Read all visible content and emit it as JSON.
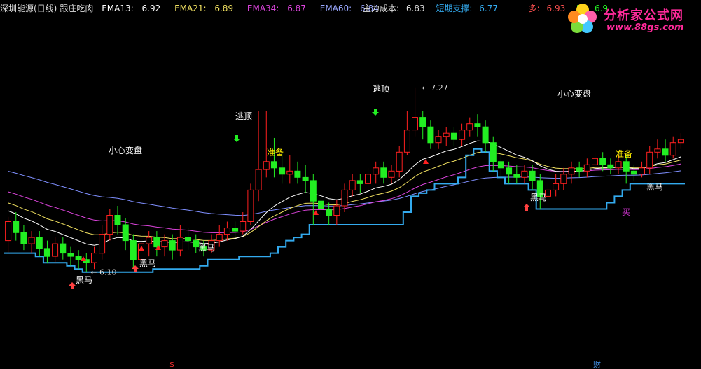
{
  "header": {
    "stock": "深圳能源(日线)",
    "indicator": "跟庄吃肉",
    "ema13_label": "EMA13:",
    "ema13_value": "6.92",
    "ema21_label": "EMA21:",
    "ema21_value": "6.89",
    "ema34_label": "EMA34:",
    "ema34_value": "6.87",
    "ema60_label": "EMA60:",
    "ema60_value": "6.84",
    "cost_label": "主力成本:",
    "cost_value": "6.83",
    "support_label": "短期支撑:",
    "support_value": "6.77",
    "long_label": "多:",
    "long_value": "6.93",
    "short_label": "空:",
    "short_value": "6.9"
  },
  "logo": {
    "title": "分析家公式网",
    "url": "www.88gs.com"
  },
  "colors": {
    "up": "#ff2020",
    "down": "#22ee22",
    "support": "#33aaee",
    "ema13": "#ffffff",
    "ema21": "#f0e060",
    "ema34": "#dd44dd",
    "ema60": "#7f8fff",
    "label": "#ffffff",
    "warn": "#ffee00"
  },
  "chart_data": {
    "type": "candlestick",
    "price_labels": [
      "6.10",
      "7.27"
    ],
    "annotations": [
      "小心变盘",
      "逃顶",
      "准备",
      "黑马",
      "买"
    ],
    "bottom_marks": [
      "$",
      "财"
    ],
    "candles": [
      [
        6.3,
        6.42,
        6.22,
        6.45
      ],
      [
        6.42,
        6.35,
        6.3,
        6.48
      ],
      [
        6.35,
        6.28,
        6.24,
        6.4
      ],
      [
        6.28,
        6.32,
        6.22,
        6.36
      ],
      [
        6.32,
        6.25,
        6.2,
        6.36
      ],
      [
        6.25,
        6.2,
        6.16,
        6.3
      ],
      [
        6.2,
        6.28,
        6.16,
        6.32
      ],
      [
        6.28,
        6.22,
        6.18,
        6.32
      ],
      [
        6.22,
        6.2,
        6.14,
        6.26
      ],
      [
        6.2,
        6.18,
        6.12,
        6.24
      ],
      [
        6.18,
        6.16,
        6.1,
        6.22
      ],
      [
        6.16,
        6.22,
        6.12,
        6.26
      ],
      [
        6.22,
        6.34,
        6.18,
        6.4
      ],
      [
        6.34,
        6.46,
        6.3,
        6.5
      ],
      [
        6.46,
        6.4,
        6.34,
        6.52
      ],
      [
        6.4,
        6.3,
        6.24,
        6.44
      ],
      [
        6.3,
        6.18,
        6.12,
        6.34
      ],
      [
        6.18,
        6.28,
        6.14,
        6.32
      ],
      [
        6.28,
        6.32,
        6.2,
        6.36
      ],
      [
        6.32,
        6.26,
        6.2,
        6.36
      ],
      [
        6.26,
        6.3,
        6.2,
        6.34
      ],
      [
        6.3,
        6.24,
        6.18,
        6.34
      ],
      [
        6.24,
        6.32,
        6.2,
        6.4
      ],
      [
        6.32,
        6.3,
        6.24,
        6.38
      ],
      [
        6.3,
        6.26,
        6.22,
        6.34
      ],
      [
        6.26,
        6.24,
        6.2,
        6.3
      ],
      [
        6.24,
        6.3,
        6.22,
        6.34
      ],
      [
        6.3,
        6.34,
        6.26,
        6.4
      ],
      [
        6.34,
        6.38,
        6.3,
        6.42
      ],
      [
        6.38,
        6.36,
        6.32,
        6.42
      ],
      [
        6.36,
        6.42,
        6.34,
        6.48
      ],
      [
        6.42,
        6.62,
        6.4,
        6.66
      ],
      [
        6.62,
        6.75,
        6.55,
        7.12
      ],
      [
        6.75,
        6.8,
        6.7,
        7.12
      ],
      [
        6.8,
        6.76,
        6.7,
        6.95
      ],
      [
        6.76,
        6.72,
        6.66,
        6.86
      ],
      [
        6.72,
        6.74,
        6.66,
        6.84
      ],
      [
        6.74,
        6.7,
        6.66,
        6.8
      ],
      [
        6.7,
        6.68,
        6.6,
        6.78
      ],
      [
        6.68,
        6.55,
        6.4,
        6.72
      ],
      [
        6.55,
        6.5,
        6.44,
        6.58
      ],
      [
        6.5,
        6.46,
        6.4,
        6.54
      ],
      [
        6.46,
        6.52,
        6.4,
        6.56
      ],
      [
        6.52,
        6.62,
        6.48,
        6.66
      ],
      [
        6.62,
        6.68,
        6.58,
        6.72
      ],
      [
        6.68,
        6.66,
        6.6,
        6.72
      ],
      [
        6.66,
        6.72,
        6.62,
        6.76
      ],
      [
        6.72,
        6.76,
        6.66,
        6.8
      ],
      [
        6.76,
        6.7,
        6.66,
        6.8
      ],
      [
        6.7,
        6.74,
        6.66,
        6.78
      ],
      [
        6.74,
        6.86,
        6.7,
        6.9
      ],
      [
        6.86,
        7.0,
        6.84,
        7.12
      ],
      [
        7.0,
        7.08,
        6.96,
        7.27
      ],
      [
        7.08,
        7.02,
        6.94,
        7.12
      ],
      [
        7.02,
        6.92,
        6.88,
        7.06
      ],
      [
        6.92,
        6.96,
        6.88,
        7.0
      ],
      [
        6.96,
        6.98,
        6.9,
        7.02
      ],
      [
        6.98,
        6.94,
        6.9,
        7.02
      ],
      [
        6.94,
        7.0,
        6.9,
        7.04
      ],
      [
        7.0,
        7.04,
        6.96,
        7.08
      ],
      [
        7.04,
        7.02,
        6.96,
        7.1
      ],
      [
        7.02,
        6.92,
        6.86,
        7.06
      ],
      [
        6.92,
        6.8,
        6.74,
        6.96
      ],
      [
        6.8,
        6.76,
        6.7,
        6.84
      ],
      [
        6.76,
        6.72,
        6.66,
        6.8
      ],
      [
        6.72,
        6.7,
        6.66,
        6.78
      ],
      [
        6.7,
        6.74,
        6.66,
        6.78
      ],
      [
        6.74,
        6.68,
        6.62,
        6.78
      ],
      [
        6.68,
        6.58,
        6.5,
        6.72
      ],
      [
        6.58,
        6.62,
        6.54,
        6.66
      ],
      [
        6.62,
        6.66,
        6.58,
        6.72
      ],
      [
        6.66,
        6.72,
        6.62,
        6.76
      ],
      [
        6.72,
        6.76,
        6.66,
        6.8
      ],
      [
        6.76,
        6.74,
        6.7,
        6.8
      ],
      [
        6.74,
        6.78,
        6.7,
        6.82
      ],
      [
        6.78,
        6.82,
        6.74,
        6.86
      ],
      [
        6.82,
        6.78,
        6.74,
        6.86
      ],
      [
        6.78,
        6.76,
        6.72,
        6.82
      ],
      [
        6.76,
        6.8,
        6.72,
        6.84
      ],
      [
        6.8,
        6.74,
        6.66,
        6.84
      ],
      [
        6.74,
        6.72,
        6.68,
        6.78
      ],
      [
        6.72,
        6.76,
        6.7,
        6.8
      ],
      [
        6.76,
        6.86,
        6.72,
        6.9
      ],
      [
        6.86,
        6.88,
        6.82,
        6.94
      ],
      [
        6.88,
        6.84,
        6.8,
        6.94
      ],
      [
        6.84,
        6.92,
        6.82,
        6.96
      ],
      [
        6.92,
        6.94,
        6.88,
        6.98
      ]
    ]
  }
}
